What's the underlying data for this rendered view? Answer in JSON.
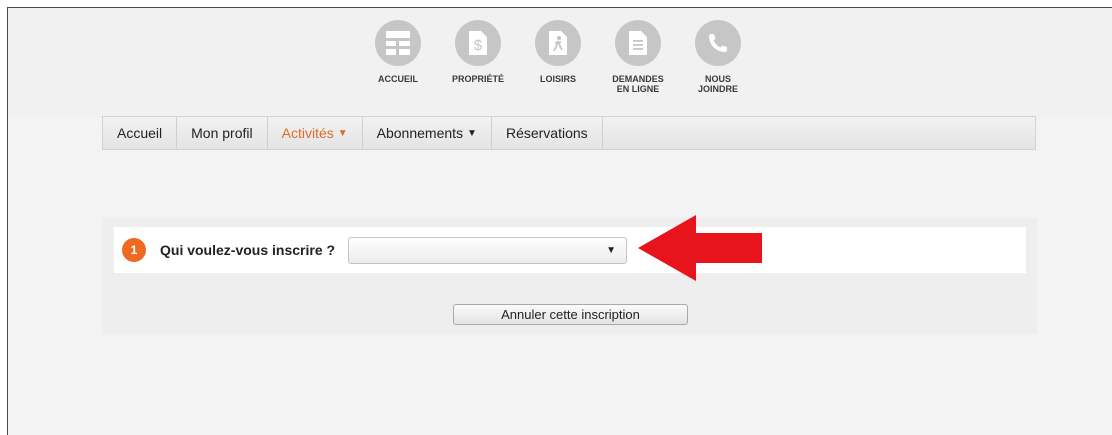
{
  "icon_nav": [
    {
      "label": "ACCUEIL",
      "icon": "home-layout-icon"
    },
    {
      "label": "PROPRIÉTÉ",
      "icon": "property-tax-icon"
    },
    {
      "label": "LOISIRS",
      "icon": "leisure-icon"
    },
    {
      "label": "DEMANDES EN LIGNE",
      "icon": "online-requests-icon"
    },
    {
      "label": "NOUS JOINDRE",
      "icon": "phone-icon"
    }
  ],
  "menu": {
    "items": [
      {
        "label": "Accueil",
        "has_dropdown": false,
        "active": false
      },
      {
        "label": "Mon profil",
        "has_dropdown": false,
        "active": false
      },
      {
        "label": "Activités",
        "has_dropdown": true,
        "active": true
      },
      {
        "label": "Abonnements",
        "has_dropdown": true,
        "active": false
      },
      {
        "label": "Réservations",
        "has_dropdown": false,
        "active": false
      }
    ],
    "caret": "▼"
  },
  "registration": {
    "step_number": "1",
    "question": "Qui voulez-vous inscrire ?",
    "select_value": "",
    "select_caret": "▼",
    "cancel_label": "Annuler cette inscription"
  },
  "colors": {
    "accent": "#ee6a23",
    "active_menu": "#e06c2a",
    "arrow": "#e8141b",
    "icon_circle": "#c6c6c6"
  }
}
